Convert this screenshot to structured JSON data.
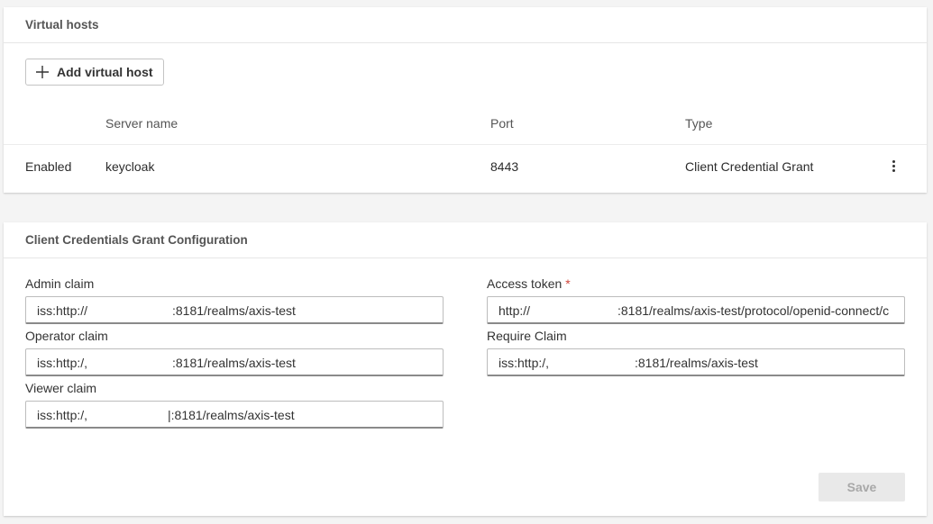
{
  "virtual_hosts": {
    "title": "Virtual hosts",
    "add_button_label": "Add virtual host",
    "columns": {
      "server_name": "Server name",
      "port": "Port",
      "type": "Type"
    },
    "rows": [
      {
        "status": "Enabled",
        "server_name": "keycloak",
        "port": "8443",
        "type": "Client Credential Grant"
      }
    ]
  },
  "ccg_config": {
    "title": "Client Credentials Grant Configuration",
    "admin_claim": {
      "label": "Admin claim",
      "value_prefix": "iss:http://",
      "value_suffix": ":8181/realms/axis-test"
    },
    "operator_claim": {
      "label": "Operator claim",
      "value_prefix": "iss:http:/,",
      "value_suffix": ":8181/realms/axis-test"
    },
    "viewer_claim": {
      "label": "Viewer claim",
      "value_prefix": "iss:http:/,",
      "value_suffix": "|:8181/realms/axis-test"
    },
    "access_token": {
      "label": "Access token",
      "required_mark": "*",
      "value_prefix": "http://",
      "value_suffix": ":8181/realms/axis-test/protocol/openid-connect/c"
    },
    "require_claim": {
      "label": "Require Claim",
      "value_prefix": "iss:http:/,",
      "value_suffix": ":8181/realms/axis-test"
    },
    "save_label": "Save"
  },
  "icons": {
    "add": "plus-icon",
    "row_menu": "kebab-menu-icon"
  },
  "colors": {
    "background": "#f4f4f4",
    "card": "#ffffff",
    "required": "#d0463b",
    "save_disabled_bg": "#e9e9e9",
    "save_disabled_text": "#a8a8a8"
  }
}
